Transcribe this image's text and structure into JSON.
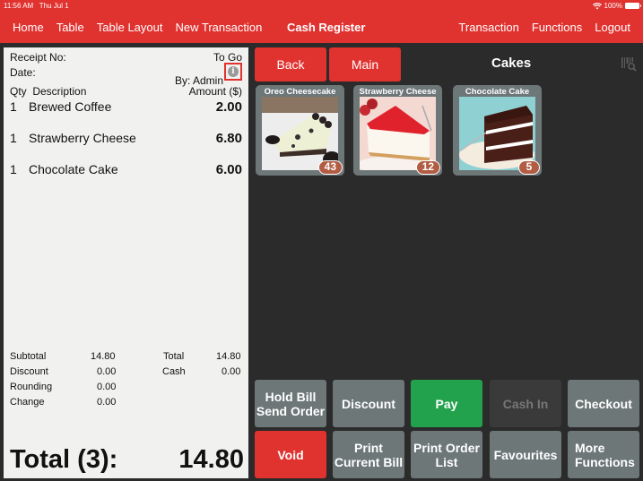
{
  "status_bar": {
    "time": "11:56 AM",
    "date": "Thu Jul 1",
    "battery": "100%"
  },
  "nav": {
    "left": [
      "Home",
      "Table",
      "Table Layout",
      "New Transaction"
    ],
    "title": "Cash Register",
    "right": [
      "Transaction",
      "Functions",
      "Logout"
    ]
  },
  "receipt": {
    "receipt_no_label": "Receipt No:",
    "order_type": "To Go",
    "date_label": "Date:",
    "by_label": "By: Admin",
    "info_icon": "i",
    "col_qty": "Qty",
    "col_desc": "Description",
    "col_amount": "Amount ($)",
    "items": [
      {
        "qty": "1",
        "desc": "Brewed Coffee",
        "amount": "2.00"
      },
      {
        "qty": "1",
        "desc": "Strawberry Cheese",
        "amount": "6.80"
      },
      {
        "qty": "1",
        "desc": "Chocolate Cake",
        "amount": "6.00"
      }
    ],
    "summary_left": [
      {
        "label": "Subtotal",
        "value": "14.80"
      },
      {
        "label": "Discount",
        "value": "0.00"
      },
      {
        "label": "Rounding",
        "value": "0.00"
      },
      {
        "label": "Change",
        "value": "0.00"
      }
    ],
    "summary_right": [
      {
        "label": "Total",
        "value": "14.80"
      },
      {
        "label": "Cash",
        "value": "0.00"
      }
    ],
    "grand_label": "Total (3):",
    "grand_value": "14.80"
  },
  "menu": {
    "back_label": "Back",
    "main_label": "Main",
    "category_title": "Cakes",
    "products": [
      {
        "name": "Oreo Cheesecake",
        "count": "43"
      },
      {
        "name": "Strawberry Cheese",
        "count": "12"
      },
      {
        "name": "Chocolate Cake",
        "count": "5"
      }
    ]
  },
  "functions": {
    "hold_bill": "Hold Bill\nSend Order",
    "discount": "Discount",
    "pay": "Pay",
    "cash_in": "Cash In",
    "checkout": "Checkout",
    "void": "Void",
    "print_bill": "Print\nCurrent Bill",
    "print_order": "Print Order\nList",
    "favourites": "Favourites",
    "more": "More\nFunctions"
  }
}
